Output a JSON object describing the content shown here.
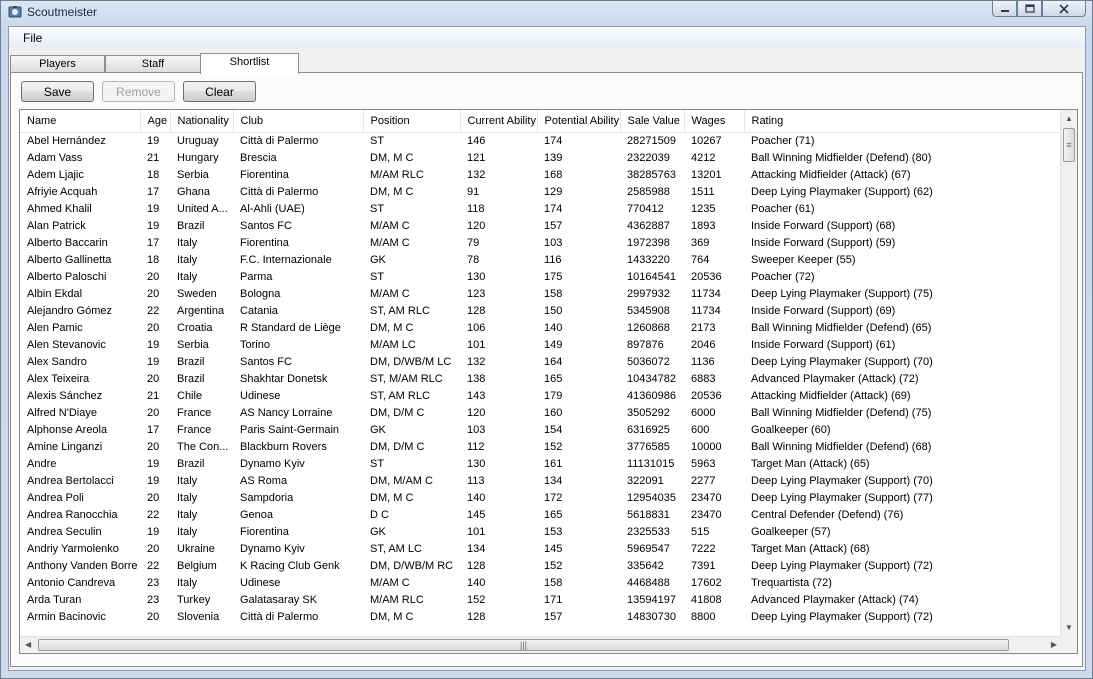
{
  "window": {
    "title": "Scoutmeister"
  },
  "menu": {
    "file": "File"
  },
  "tabs": [
    {
      "label": "Players"
    },
    {
      "label": "Staff"
    },
    {
      "label": "Shortlist",
      "active": true
    }
  ],
  "toolbar": {
    "save": "Save",
    "remove": "Remove",
    "clear": "Clear"
  },
  "columns": [
    "Name",
    "Age",
    "Nationality",
    "Club",
    "Position",
    "Current Ability",
    "Potential Ability",
    "Sale Value",
    "Wages",
    "Rating"
  ],
  "rows": [
    [
      "Abel Hernández",
      "19",
      "Uruguay",
      "Città di Palermo",
      "ST",
      "146",
      "174",
      "28271509",
      "10267",
      "Poacher (71)"
    ],
    [
      "Adam Vass",
      "21",
      "Hungary",
      "Brescia",
      "DM, M C",
      "121",
      "139",
      "2322039",
      "4212",
      "Ball Winning Midfielder (Defend) (80)"
    ],
    [
      "Adem Ljajic",
      "18",
      "Serbia",
      "Fiorentina",
      "M/AM RLC",
      "132",
      "168",
      "38285763",
      "13201",
      "Attacking Midfielder (Attack) (67)"
    ],
    [
      "Afriyie Acquah",
      "17",
      "Ghana",
      "Città di Palermo",
      "DM, M C",
      "91",
      "129",
      "2585988",
      "1511",
      "Deep Lying Playmaker (Support) (62)"
    ],
    [
      "Ahmed Khalil",
      "19",
      "United A...",
      "Al-Ahli (UAE)",
      "ST",
      "118",
      "174",
      "770412",
      "1235",
      "Poacher (61)"
    ],
    [
      "Alan Patrick",
      "19",
      "Brazil",
      "Santos FC",
      "M/AM C",
      "120",
      "157",
      "4362887",
      "1893",
      "Inside Forward (Support) (68)"
    ],
    [
      "Alberto Baccarin",
      "17",
      "Italy",
      "Fiorentina",
      "M/AM C",
      "79",
      "103",
      "1972398",
      "369",
      "Inside Forward (Support) (59)"
    ],
    [
      "Alberto Gallinetta",
      "18",
      "Italy",
      "F.C. Internazionale",
      "GK",
      "78",
      "116",
      "1433220",
      "764",
      "Sweeper Keeper (55)"
    ],
    [
      "Alberto Paloschi",
      "20",
      "Italy",
      "Parma",
      "ST",
      "130",
      "175",
      "10164541",
      "20536",
      "Poacher (72)"
    ],
    [
      "Albin Ekdal",
      "20",
      "Sweden",
      "Bologna",
      "M/AM C",
      "123",
      "158",
      "2997932",
      "11734",
      "Deep Lying Playmaker (Support) (75)"
    ],
    [
      "Alejandro Gómez",
      "22",
      "Argentina",
      "Catania",
      "ST, AM RLC",
      "128",
      "150",
      "5345908",
      "11734",
      "Inside Forward (Support) (69)"
    ],
    [
      "Alen Pamic",
      "20",
      "Croatia",
      "R Standard de Liège",
      "DM, M C",
      "106",
      "140",
      "1260868",
      "2173",
      "Ball Winning Midfielder (Defend) (65)"
    ],
    [
      "Alen Stevanovic",
      "19",
      "Serbia",
      "Torino",
      "M/AM LC",
      "101",
      "149",
      "897876",
      "2046",
      "Inside Forward (Support) (61)"
    ],
    [
      "Alex Sandro",
      "19",
      "Brazil",
      "Santos FC",
      "DM, D/WB/M LC",
      "132",
      "164",
      "5036072",
      "1136",
      "Deep Lying Playmaker (Support) (70)"
    ],
    [
      "Alex Teixeira",
      "20",
      "Brazil",
      "Shakhtar Donetsk",
      "ST, M/AM RLC",
      "138",
      "165",
      "10434782",
      "6883",
      "Advanced Playmaker (Attack) (72)"
    ],
    [
      "Alexis Sánchez",
      "21",
      "Chile",
      "Udinese",
      "ST, AM RLC",
      "143",
      "179",
      "41360986",
      "20536",
      "Attacking Midfielder (Attack) (69)"
    ],
    [
      "Alfred N'Diaye",
      "20",
      "France",
      "AS Nancy Lorraine",
      "DM, D/M C",
      "120",
      "160",
      "3505292",
      "6000",
      "Ball Winning Midfielder (Defend) (75)"
    ],
    [
      "Alphonse Areola",
      "17",
      "France",
      "Paris Saint-Germain",
      "GK",
      "103",
      "154",
      "6316925",
      "600",
      "Goalkeeper (60)"
    ],
    [
      "Amine Linganzi",
      "20",
      "The Con...",
      "Blackburn Rovers",
      "DM, D/M C",
      "112",
      "152",
      "3776585",
      "10000",
      "Ball Winning Midfielder (Defend) (68)"
    ],
    [
      "Andre",
      "19",
      "Brazil",
      "Dynamo Kyiv",
      "ST",
      "130",
      "161",
      "11131015",
      "5963",
      "Target Man (Attack) (65)"
    ],
    [
      "Andrea Bertolacci",
      "19",
      "Italy",
      "AS Roma",
      "DM, M/AM C",
      "113",
      "134",
      "322091",
      "2277",
      "Deep Lying Playmaker (Support) (70)"
    ],
    [
      "Andrea Poli",
      "20",
      "Italy",
      "Sampdoria",
      "DM, M C",
      "140",
      "172",
      "12954035",
      "23470",
      "Deep Lying Playmaker (Support) (77)"
    ],
    [
      "Andrea Ranocchia",
      "22",
      "Italy",
      "Genoa",
      "D C",
      "145",
      "165",
      "5618831",
      "23470",
      "Central Defender (Defend) (76)"
    ],
    [
      "Andrea Seculin",
      "19",
      "Italy",
      "Fiorentina",
      "GK",
      "101",
      "153",
      "2325533",
      "515",
      "Goalkeeper (57)"
    ],
    [
      "Andriy Yarmolenko",
      "20",
      "Ukraine",
      "Dynamo Kyiv",
      "ST, AM LC",
      "134",
      "145",
      "5969547",
      "7222",
      "Target Man (Attack) (68)"
    ],
    [
      "Anthony Vanden Borre",
      "22",
      "Belgium",
      "K Racing Club Genk",
      "DM, D/WB/M RC",
      "128",
      "152",
      "335642",
      "7391",
      "Deep Lying Playmaker (Support) (72)"
    ],
    [
      "Antonio Candreva",
      "23",
      "Italy",
      "Udinese",
      "M/AM C",
      "140",
      "158",
      "4468488",
      "17602",
      "Trequartista (72)"
    ],
    [
      "Arda Turan",
      "23",
      "Turkey",
      "Galatasaray SK",
      "M/AM RLC",
      "152",
      "171",
      "13594197",
      "41808",
      "Advanced Playmaker (Attack) (74)"
    ],
    [
      "Armin Bacinovic",
      "20",
      "Slovenia",
      "Città di Palermo",
      "DM, M C",
      "128",
      "157",
      "14830730",
      "8800",
      "Deep Lying Playmaker (Support) (72)"
    ]
  ]
}
